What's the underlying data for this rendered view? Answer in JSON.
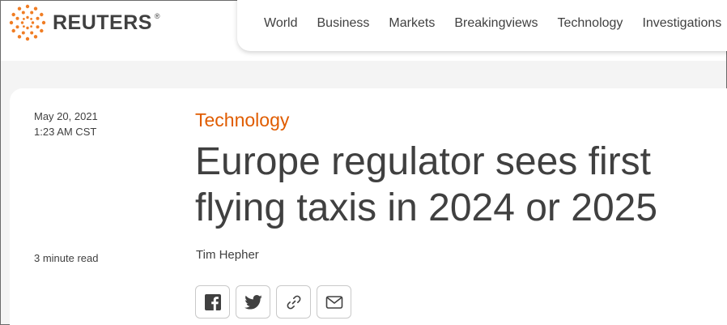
{
  "header": {
    "logo_text": "REUTERS",
    "logo_reg": "®",
    "nav": [
      "World",
      "Business",
      "Markets",
      "Breakingviews",
      "Technology",
      "Investigations"
    ]
  },
  "article": {
    "date": "May 20, 2021",
    "time": "1:23 AM CST",
    "read_time": "3 minute read",
    "section": "Technology",
    "headline_line1": "Europe regulator sees first",
    "headline_line2": "flying taxis in 2024 or 2025",
    "author": "Tim Hepher"
  },
  "share_icons": [
    "facebook-icon",
    "twitter-icon",
    "link-icon",
    "email-icon"
  ],
  "colors": {
    "brand_orange": "#e05c00",
    "text": "#404040",
    "background": "#f4f4f4"
  }
}
